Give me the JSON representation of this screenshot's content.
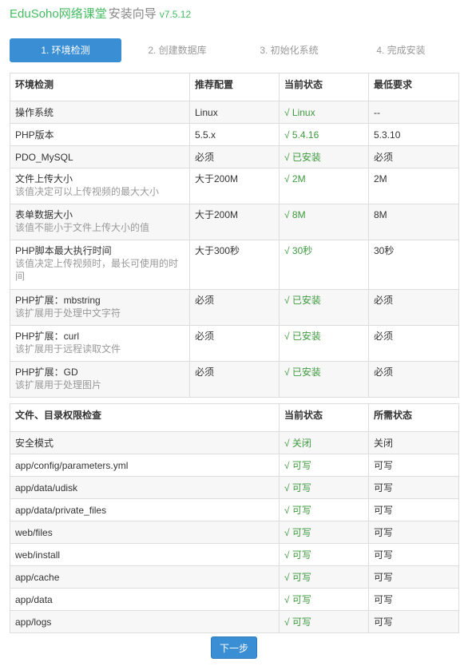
{
  "header": {
    "brand": "EduSoho网络课堂",
    "title": "安装向导",
    "version": "v7.5.12"
  },
  "steps": [
    {
      "label": "1. 环境检测",
      "active": true
    },
    {
      "label": "2. 创建数据库",
      "active": false
    },
    {
      "label": "3. 初始化系统",
      "active": false
    },
    {
      "label": "4. 完成安装",
      "active": false
    }
  ],
  "env_table": {
    "headers": [
      "环境检测",
      "推荐配置",
      "当前状态",
      "最低要求"
    ],
    "rows": [
      {
        "name": "操作系统",
        "desc": "",
        "recommended": "Linux",
        "current": "√ Linux",
        "minimum": "--"
      },
      {
        "name": "PHP版本",
        "desc": "",
        "recommended": "5.5.x",
        "current": "√ 5.4.16",
        "minimum": "5.3.10"
      },
      {
        "name": "PDO_MySQL",
        "desc": "",
        "recommended": "必须",
        "current": "√ 已安装",
        "minimum": "必须"
      },
      {
        "name": "文件上传大小",
        "desc": "该值决定可以上传视频的最大大小",
        "recommended": "大于200M",
        "current": "√ 2M",
        "minimum": "2M"
      },
      {
        "name": "表单数据大小",
        "desc": "该值不能小于文件上传大小的值",
        "recommended": "大于200M",
        "current": "√ 8M",
        "minimum": "8M"
      },
      {
        "name": "PHP脚本最大执行时间",
        "desc": "该值决定上传视频时，最长可使用的时间",
        "recommended": "大于300秒",
        "current": "√ 30秒",
        "minimum": "30秒"
      },
      {
        "name": "PHP扩展：mbstring",
        "desc": "该扩展用于处理中文字符",
        "recommended": "必须",
        "current": "√ 已安装",
        "minimum": "必须"
      },
      {
        "name": "PHP扩展：curl",
        "desc": "该扩展用于远程读取文件",
        "recommended": "必须",
        "current": "√ 已安装",
        "minimum": "必须"
      },
      {
        "name": "PHP扩展：GD",
        "desc": "该扩展用于处理图片",
        "recommended": "必须",
        "current": "√ 已安装",
        "minimum": "必须"
      }
    ]
  },
  "perm_table": {
    "headers": [
      "文件、目录权限检查",
      "当前状态",
      "所需状态"
    ],
    "rows": [
      {
        "path": "安全模式",
        "current": "√ 关闭",
        "required": "关闭"
      },
      {
        "path": "app/config/parameters.yml",
        "current": "√ 可写",
        "required": "可写"
      },
      {
        "path": "app/data/udisk",
        "current": "√ 可写",
        "required": "可写"
      },
      {
        "path": "app/data/private_files",
        "current": "√ 可写",
        "required": "可写"
      },
      {
        "path": "web/files",
        "current": "√ 可写",
        "required": "可写"
      },
      {
        "path": "web/install",
        "current": "√ 可写",
        "required": "可写"
      },
      {
        "path": "app/cache",
        "current": "√ 可写",
        "required": "可写"
      },
      {
        "path": "app/data",
        "current": "√ 可写",
        "required": "可写"
      },
      {
        "path": "app/logs",
        "current": "√ 可写",
        "required": "可写"
      }
    ]
  },
  "next_button": "下一步"
}
